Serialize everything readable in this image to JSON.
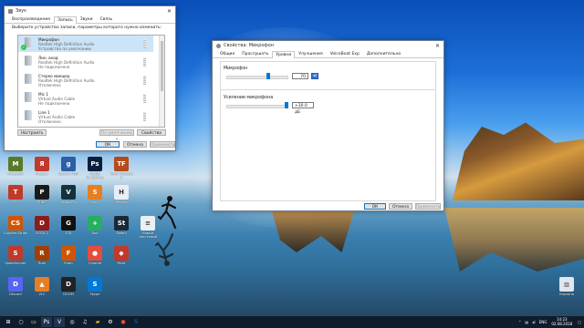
{
  "sound_dialog": {
    "title": "Звук",
    "tabs": [
      "Воспроизведение",
      "Запись",
      "Звуки",
      "Связь"
    ],
    "active_tab": 1,
    "instruction": "Выберите устройство записи, параметры которого нужно изменить:",
    "devices": [
      {
        "name": "Микрофон",
        "line2": "Realtek High Definition Audio",
        "line3": "Устройство по умолчанию",
        "selected": true,
        "default": true
      },
      {
        "name": "Лин. вход",
        "line2": "Realtek High Definition Audio",
        "line3": "Не подключено",
        "selected": false,
        "default": false
      },
      {
        "name": "Стерео микшер",
        "line2": "Realtek High Definition Audio",
        "line3": "Отключено",
        "selected": false,
        "default": false
      },
      {
        "name": "Mic 1",
        "line2": "Virtual Audio Cable",
        "line3": "Не подключено",
        "selected": false,
        "default": false
      },
      {
        "name": "Line 1",
        "line2": "Virtual Audio Cable",
        "line3": "Отключено",
        "selected": false,
        "default": false
      }
    ],
    "configure_label": "Настроить",
    "default_label": "По умолчанию",
    "properties_label": "Свойства",
    "ok_label": "ОК",
    "cancel_label": "Отмена",
    "apply_label": "Применить"
  },
  "props_dialog": {
    "title": "Свойства: Микрофон",
    "tabs": [
      "Общие",
      "Прослушать",
      "Уровни",
      "Улучшения",
      "Voicemeeter",
      "Дополнительно"
    ],
    "tab_display": [
      "Общие",
      "Прослушать",
      "Уровни",
      "Улучшения",
      "VoiceBoat Exp",
      "Дополнительно"
    ],
    "active_tab": 2,
    "mic_label": "Микрофон",
    "mic_value": "70",
    "mic_level": 0.7,
    "boost_label": "Усиление микрофона",
    "boost_value": "+30.0 дБ",
    "boost_level": 1.0,
    "ok_label": "ОК",
    "cancel_label": "Отмена",
    "apply_label": "Применить"
  },
  "desktop_icons": [
    {
      "label": "Minecraft",
      "color": "#5a7a2a",
      "glyph": "M"
    },
    {
      "label": "Яндекс",
      "color": "#c0392b",
      "glyph": "Я"
    },
    {
      "label": "Garry's Mod",
      "color": "#2b5fa6",
      "glyph": "g"
    },
    {
      "label": "Adobe Photoshop",
      "color": "#0a1f3b",
      "glyph": "Ps"
    },
    {
      "label": "Team Fortress 2",
      "color": "#b54a1a",
      "glyph": "TF"
    },
    {
      "label": "TF2",
      "color": "#c0392b",
      "glyph": "T"
    },
    {
      "label": "PUBG",
      "color": "#1a1a1a",
      "glyph": "P"
    },
    {
      "label": "Vegas Pro",
      "color": "#14323c",
      "glyph": "V"
    },
    {
      "label": "Sony",
      "color": "#e67e22",
      "glyph": "S"
    },
    {
      "label": "Hacker",
      "color": "#e8eef5",
      "glyph": "H"
    },
    {
      "label": "Counter-Strike",
      "color": "#d35400",
      "glyph": "CS"
    },
    {
      "label": "DOTA 2",
      "color": "#8e1b1b",
      "glyph": "D"
    },
    {
      "label": "GTA",
      "color": "#111",
      "glyph": "G"
    },
    {
      "label": "Tool",
      "color": "#27ae60",
      "glyph": "+"
    },
    {
      "label": "Steam",
      "color": "#1b2838",
      "glyph": "St"
    },
    {
      "label": "Новый текстовый",
      "color": "#ecf0f1",
      "glyph": "≡"
    },
    {
      "label": "Speedrunner",
      "color": "#c0392b",
      "glyph": "S"
    },
    {
      "label": "Rust",
      "color": "#a04000",
      "glyph": "R"
    },
    {
      "label": "Flash",
      "color": "#d35400",
      "glyph": "F"
    },
    {
      "label": "Chrome",
      "color": "#e74c3c",
      "glyph": "●"
    },
    {
      "label": "Paint",
      "color": "#c0392b",
      "glyph": "◆"
    },
    {
      "label": "Discord",
      "color": "#5865f2",
      "glyph": "D"
    },
    {
      "label": "VLC",
      "color": "#e67e22",
      "glyph": "▲"
    },
    {
      "label": "DOOM",
      "color": "#222",
      "glyph": "D"
    },
    {
      "label": "Skype",
      "color": "#0078d7",
      "glyph": "S"
    },
    {
      "label": "Корзина",
      "color": "#dfe6ee",
      "glyph": "🗑"
    }
  ],
  "taskbar": {
    "lang": "ENG",
    "time": "14:23",
    "date": "02.08.2018"
  }
}
